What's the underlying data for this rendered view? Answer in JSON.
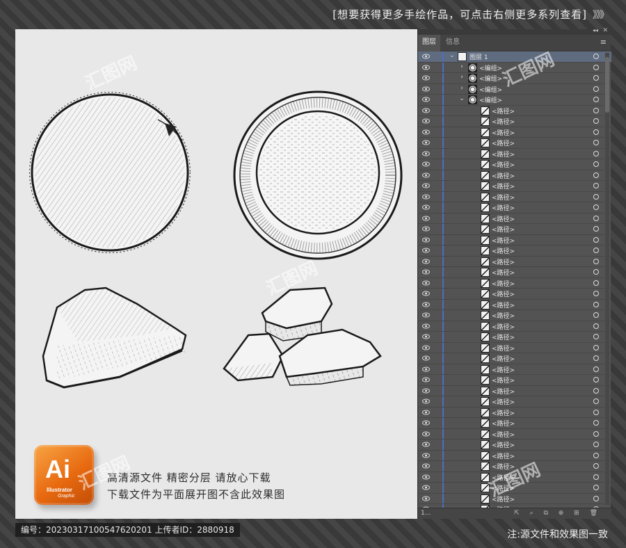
{
  "top_banner": {
    "text": "[想要获得更多手绘作品，可点击右侧更多系列查看]",
    "arrows": "》》》"
  },
  "artwork": {
    "items": [
      "whole-coconut",
      "half-coconut",
      "coconut-wedge",
      "coconut-pieces"
    ]
  },
  "badge": {
    "text": "Ai",
    "sub": "Illustrator",
    "sub2": "Graphic"
  },
  "promo": {
    "line1": "高清源文件   精密分层   请放心下载",
    "line2": "下载文件为平面展开图不含此效果图"
  },
  "panel": {
    "tabs": [
      "图层",
      "信息"
    ],
    "active_tab": "图层",
    "layer_name": "图层 1",
    "groups": [
      "<编组>",
      "<编组>",
      "<编组>",
      "<编组>"
    ],
    "path_label": "<路径>",
    "path_count": 38,
    "footer_count": "1..."
  },
  "bottom": {
    "info": "编号：20230317100547620201  上传者ID：2880918",
    "note": "注:源文件和效果图一致"
  },
  "watermark_text": "汇图网"
}
